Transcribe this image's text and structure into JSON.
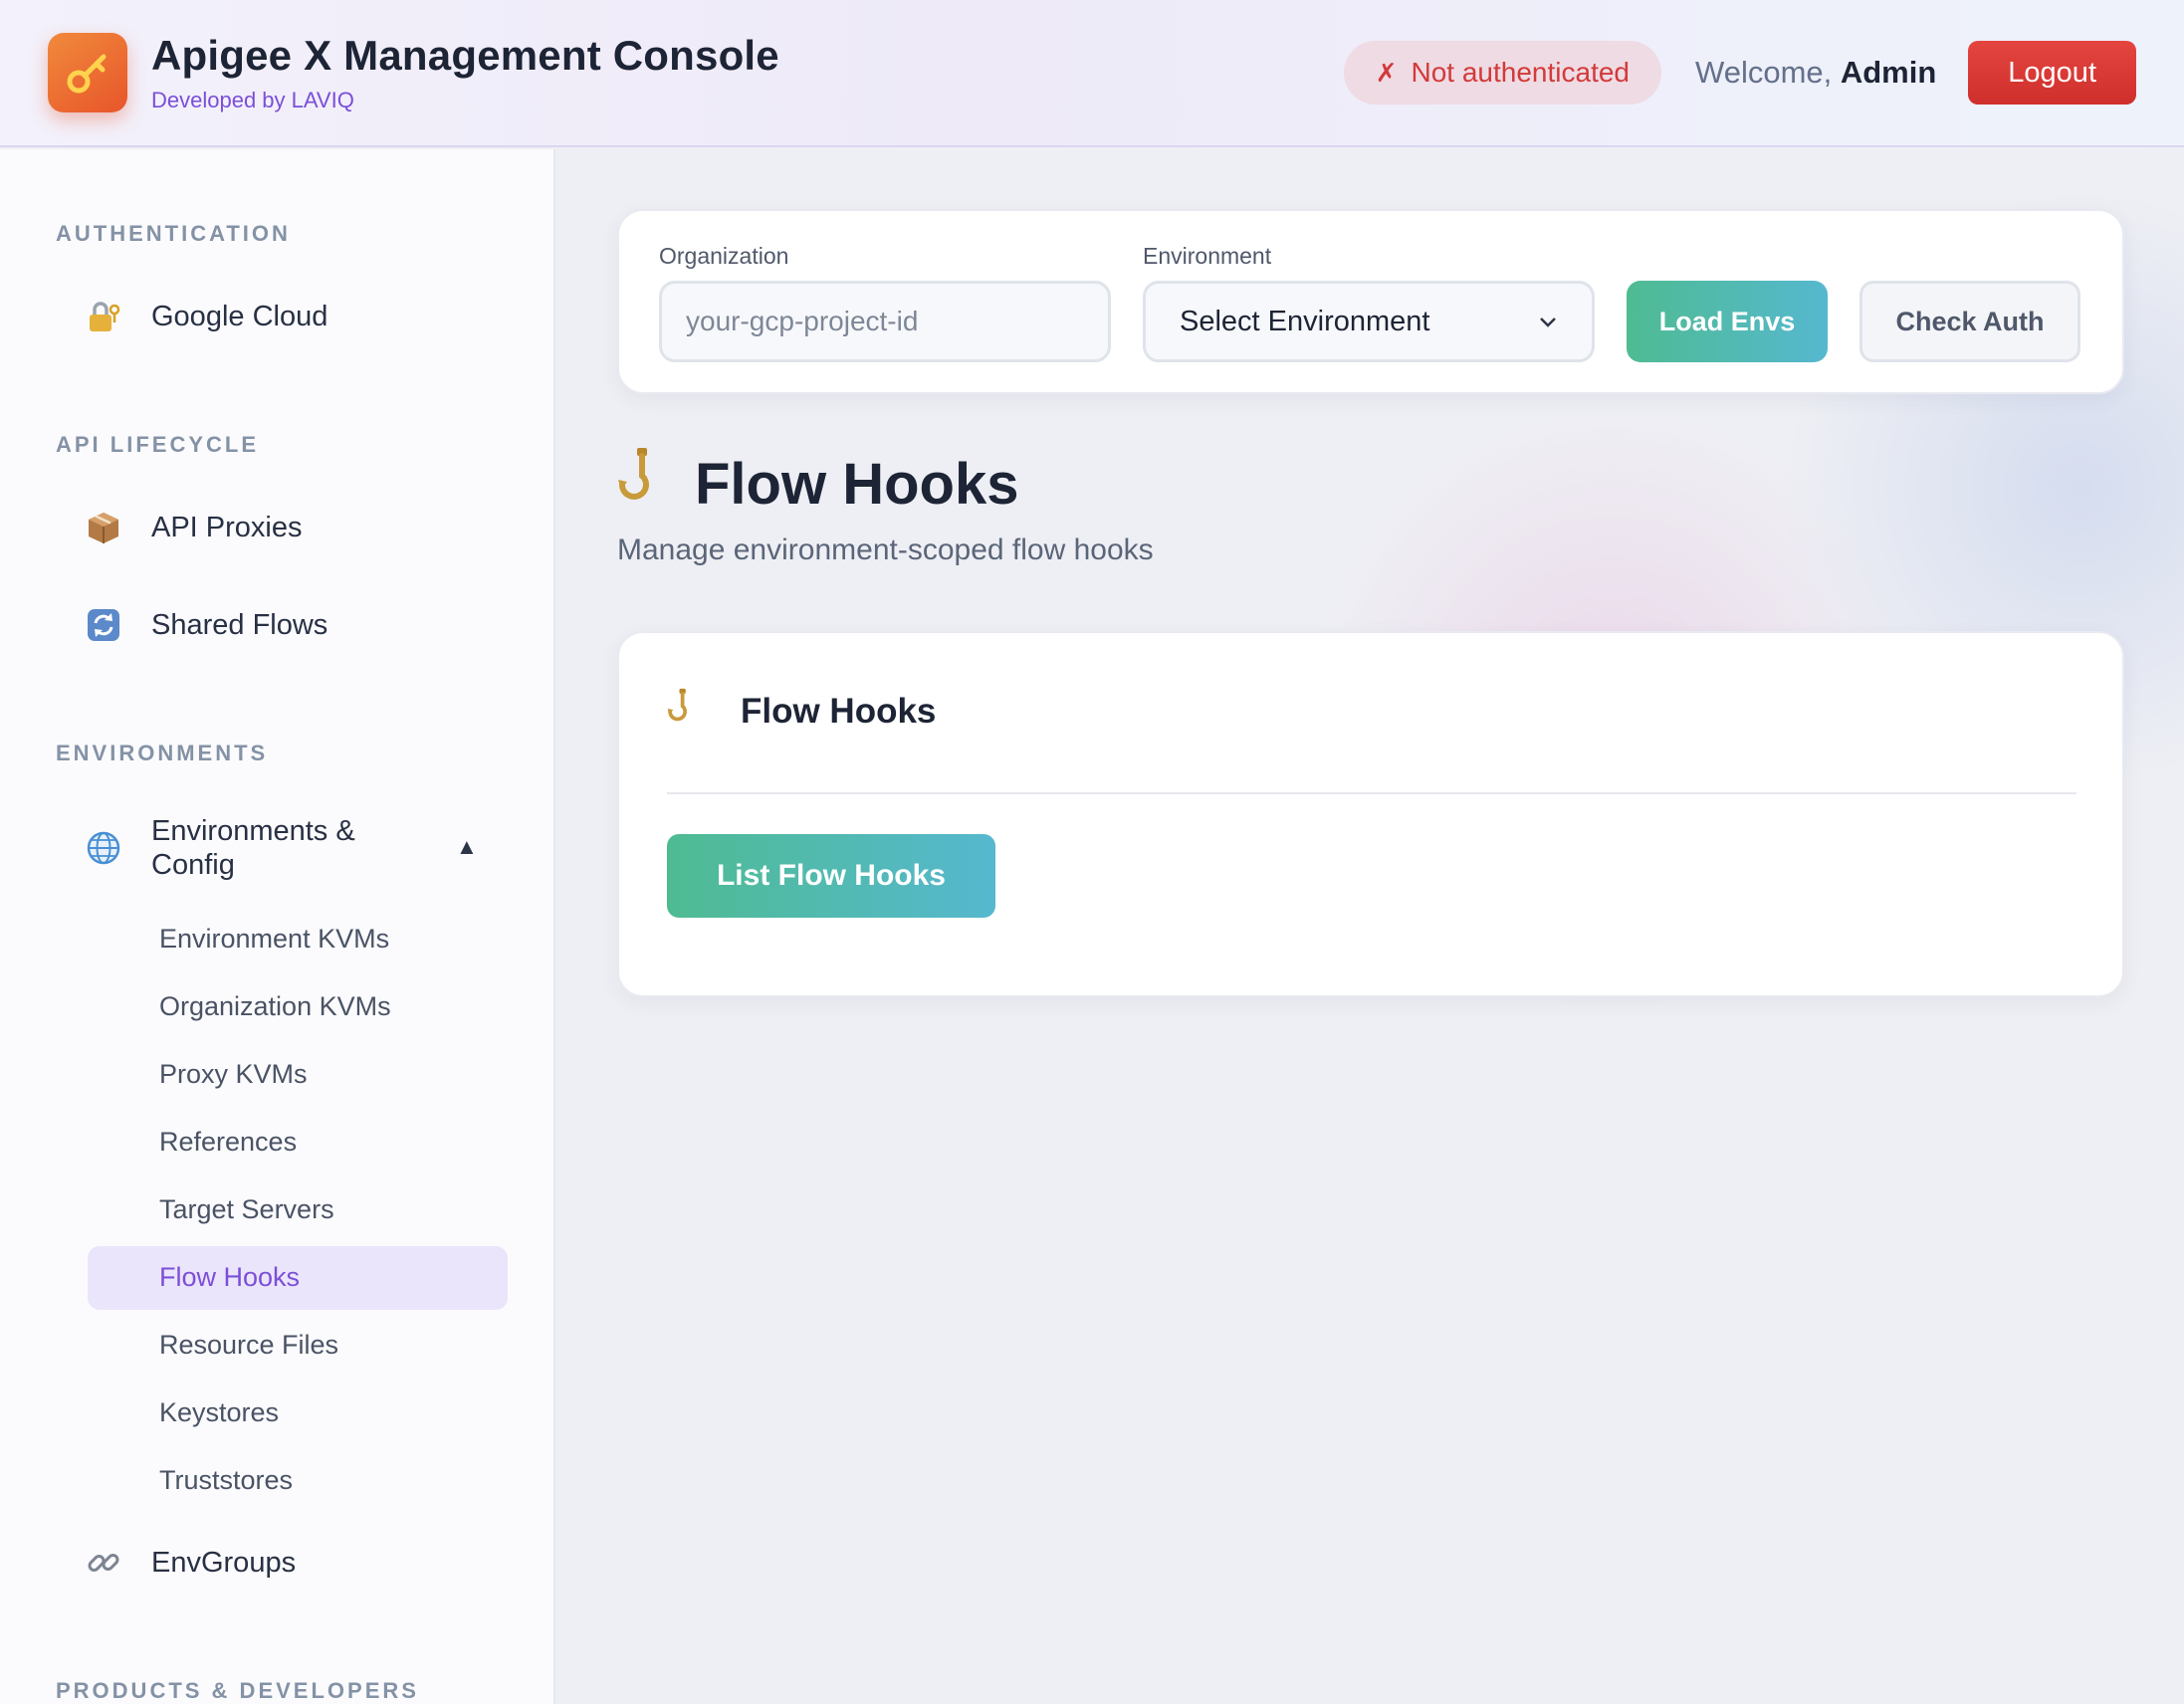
{
  "header": {
    "title": "Apigee X Management Console",
    "subtitle": "Developed by LAVIQ",
    "logo_icon": "key-icon",
    "auth_status_mark": "✗",
    "auth_status": "Not authenticated",
    "welcome_prefix": "Welcome, ",
    "welcome_user": "Admin",
    "logout_label": "Logout"
  },
  "sidebar": {
    "sections": {
      "authentication": "AUTHENTICATION",
      "api_lifecycle": "API LIFECYCLE",
      "environments": "ENVIRONMENTS",
      "products_developers": "PRODUCTS & DEVELOPERS"
    },
    "items": {
      "google_cloud": {
        "label": "Google Cloud",
        "icon": "lock-key-icon"
      },
      "api_proxies": {
        "label": "API Proxies",
        "icon": "package-icon"
      },
      "shared_flows": {
        "label": "Shared Flows",
        "icon": "refresh-icon"
      },
      "environments_config": {
        "label": "Environments & Config",
        "icon": "globe-icon",
        "expanded": true
      },
      "envgroups": {
        "label": "EnvGroups",
        "icon": "link-icon"
      }
    },
    "sub_items": [
      "Environment KVMs",
      "Organization KVMs",
      "Proxy KVMs",
      "References",
      "Target Servers",
      "Flow Hooks",
      "Resource Files",
      "Keystores",
      "Truststores"
    ],
    "active_sub_item": "Flow Hooks"
  },
  "toolbar": {
    "org_label": "Organization",
    "org_value": "",
    "org_placeholder": "your-gcp-project-id",
    "env_label": "Environment",
    "env_selected": "Select Environment",
    "load_label": "Load Envs",
    "check_label": "Check Auth"
  },
  "main": {
    "title": "Flow Hooks",
    "description": "Manage environment-scoped flow hooks",
    "card_title": "Flow Hooks",
    "list_button": "List Flow Hooks"
  },
  "colors": {
    "accent": "#7b4fd8",
    "danger": "#d23a3a",
    "primary_gradient_start": "#4fbb92",
    "primary_gradient_end": "#56b8cf"
  }
}
